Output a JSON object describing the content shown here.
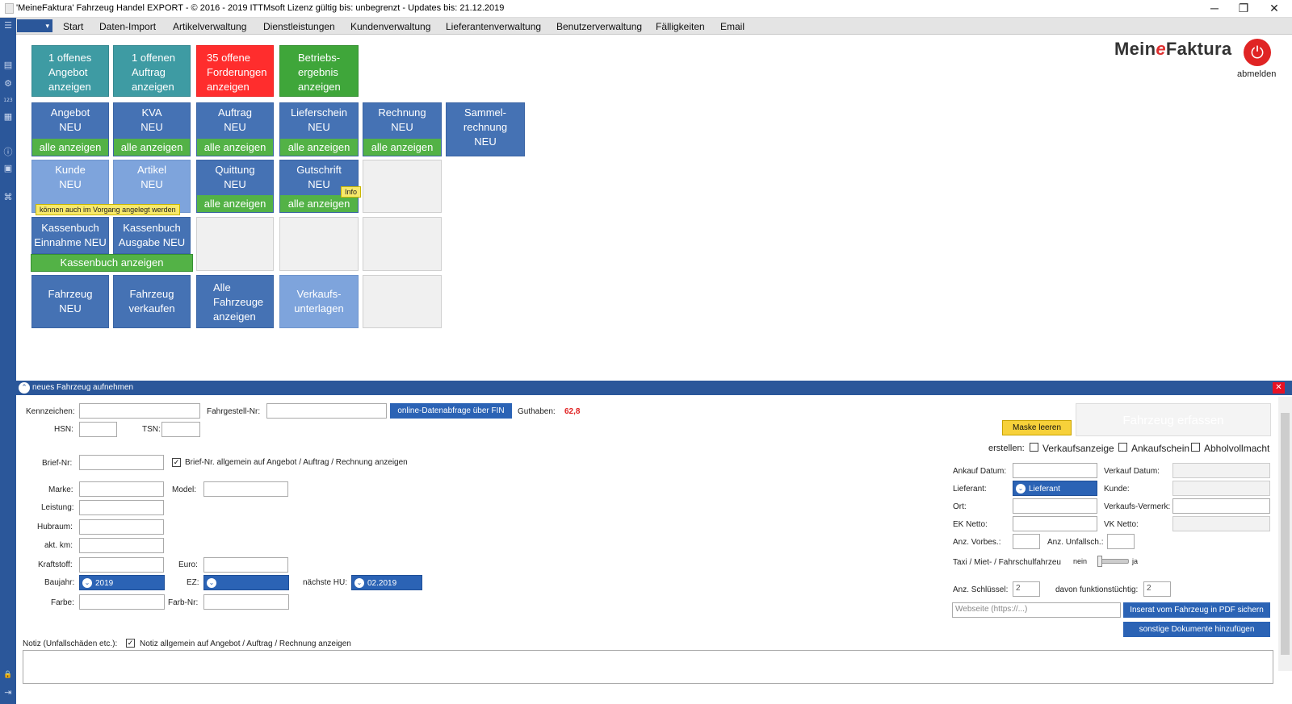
{
  "window": {
    "title": "'MeineFaktura' Fahrzeug Handel EXPORT - © 2016 - 2019 ITTMsoft Lizenz gültig bis: unbegrenzt - Updates bis: 21.12.2019",
    "minimize": "─",
    "restore": "❐",
    "close": "✕"
  },
  "menu": {
    "dropdown_glyph": "▾",
    "items": [
      "Start",
      "Daten-Import",
      "Artikelverwaltung",
      "Dienstleistungen",
      "Kundenverwaltung",
      "Lieferantenverwaltung",
      "Benutzerverwaltung",
      "Fälligkeiten",
      "Email"
    ]
  },
  "leftbar": {
    "icons": [
      "menu-icon",
      "chart-icon",
      "settings-icon",
      "numbers-icon",
      "list-icon",
      "info-icon",
      "chat-icon",
      "sitemap-icon",
      "lock-icon",
      "exit-icon"
    ],
    "glyphs": [
      "☰",
      "▤",
      "⚙",
      "123",
      "▦",
      "ⓘ",
      "▣",
      "⌘",
      "🔒",
      "⇥"
    ]
  },
  "logo": {
    "part1": "Mein",
    "part2": "e",
    "part3": "Faktura",
    "power_glyph": "⏻",
    "logout": "abmelden"
  },
  "tiles": {
    "offenes_angebot": [
      "1 offenes",
      "Angebot",
      "anzeigen"
    ],
    "offener_auftrag": [
      "1 offenen",
      "Auftrag",
      "anzeigen"
    ],
    "offene_forderungen": [
      "35 offene",
      "Forderungen",
      "anzeigen"
    ],
    "betriebsergebnis": [
      "Betriebs-",
      "ergebnis",
      "anzeigen"
    ],
    "angebot": [
      "Angebot",
      "NEU"
    ],
    "kva": [
      "KVA",
      "NEU"
    ],
    "auftrag": [
      "Auftrag",
      "NEU"
    ],
    "lieferschein": [
      "Lieferschein",
      "NEU"
    ],
    "rechnung": [
      "Rechnung",
      "NEU"
    ],
    "sammelrechnung": [
      "Sammel-",
      "rechnung",
      "NEU"
    ],
    "alle_anzeigen": "alle anzeigen",
    "kunde": [
      "Kunde",
      "NEU"
    ],
    "artikel": [
      "Artikel",
      "NEU"
    ],
    "quittung": [
      "Quittung",
      "NEU"
    ],
    "gutschrift": [
      "Gutschrift",
      "NEU"
    ],
    "vorgang_hint": "können auch im Vorgang angelegt werden",
    "info_hint": "Info",
    "kassenbuch_einnahme": [
      "Kassenbuch",
      "Einnahme NEU"
    ],
    "kassenbuch_ausgabe": [
      "Kassenbuch",
      "Ausgabe NEU"
    ],
    "kassenbuch_anzeigen": "Kassenbuch anzeigen",
    "fahrzeug_neu": [
      "Fahrzeug",
      "NEU"
    ],
    "fahrzeug_verkaufen": [
      "Fahrzeug",
      "verkaufen"
    ],
    "alle_fahrzeuge": [
      "Alle",
      "Fahrzeuge",
      "anzeigen"
    ],
    "verkaufsunterlagen": [
      "Verkaufs-",
      "unterlagen"
    ]
  },
  "panel": {
    "title": "neues Fahrzeug aufnehmen",
    "collapse_glyph": "⌃",
    "close_glyph": "✕",
    "kennzeichen": "Kennzeichen:",
    "fahrgestell": "Fahrgestell-Nr:",
    "online_btn": "online-Datenabfrage über FIN",
    "guthaben_label": "Guthaben:",
    "guthaben_value": "62,8",
    "hsn": "HSN:",
    "tsn": "TSN:",
    "brief_nr": "Brief-Nr:",
    "brief_chk": "Brief-Nr. allgemein auf Angebot / Auftrag / Rechnung anzeigen",
    "marke": "Marke:",
    "model": "Model:",
    "leistung": "Leistung:",
    "hubraum": "Hubraum:",
    "akt_km": "akt. km:",
    "kraftstoff": "Kraftstoff:",
    "euro": "Euro:",
    "baujahr": "Baujahr:",
    "baujahr_value": "2019",
    "ez": "EZ:",
    "ez_value": "",
    "naechste_hu": "nächste HU:",
    "hu_value": "02.2019",
    "farbe": "Farbe:",
    "farb_nr": "Farb-Nr:",
    "notiz": "Notiz (Unfallschäden etc.):",
    "notiz_chk": "Notiz allgemein auf Angebot / Auftrag / Rechnung anzeigen",
    "check_glyph": "✓",
    "dd_glyph": "⌄",
    "maske_leeren": "Maske leeren",
    "fahrzeug_erfassen": "Fahrzeug erfassen",
    "erstellen": "erstellen:",
    "verkaufsanzeige": "Verkaufsanzeige",
    "ankaufschein": "Ankaufschein",
    "abholvollmacht": "Abholvollmacht",
    "ankauf_datum": "Ankauf Datum:",
    "verkauf_datum": "Verkauf Datum:",
    "lieferant": "Lieferant:",
    "lieferant_value": "Lieferant",
    "kunde": "Kunde:",
    "ort": "Ort:",
    "verkaufs_vermerk": "Verkaufs-Vermerk:",
    "ek_netto": "EK Netto:",
    "vk_netto": "VK Netto:",
    "anz_vorbes": "Anz. Vorbes.:",
    "anz_unfallsch": "Anz. Unfallsch.:",
    "taxi": "Taxi / Miet- / Fahrschulfahrzeu",
    "nein": "nein",
    "ja": "ja",
    "anz_schluessel": "Anz. Schlüssel:",
    "anz_schluessel_value": "2",
    "davon_funktion": "davon funktionstüchtig:",
    "davon_funktion_value": "2",
    "webseite_placeholder": "Webseite (https://...)",
    "inserat_btn": "Inserat vom Fahrzeug in PDF sichern",
    "sonstige_btn": "sonstige Dokumente hinzufügen"
  }
}
